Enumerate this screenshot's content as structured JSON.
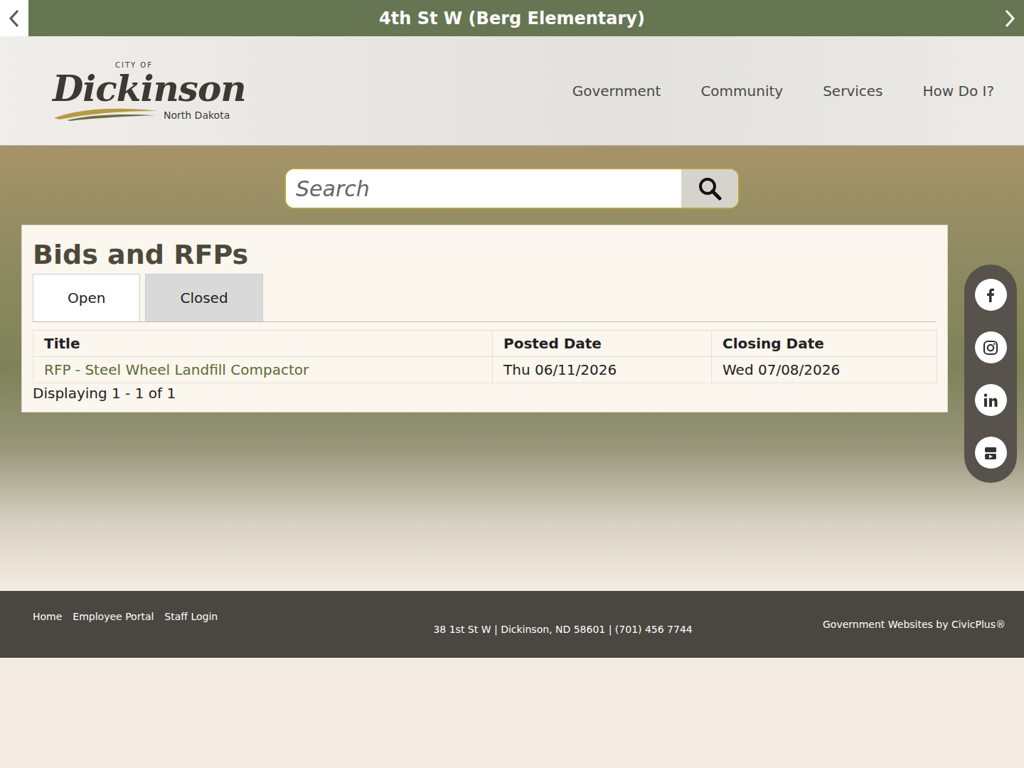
{
  "alert_bar": {
    "title": "4th St W (Berg Elementary)"
  },
  "logo": {
    "prefix": "CITY OF",
    "name": "Dickinson",
    "region": "North Dakota"
  },
  "nav": [
    "Government",
    "Community",
    "Services",
    "How Do I?"
  ],
  "search": {
    "placeholder": "Search"
  },
  "page": {
    "title": "Bids and RFPs"
  },
  "tabs": [
    {
      "label": "Open",
      "selected": true
    },
    {
      "label": "Closed",
      "selected": false
    }
  ],
  "table": {
    "columns": [
      "Title",
      "Posted Date",
      "Closing Date"
    ],
    "rows": [
      {
        "title": "RFP - Steel Wheel Landfill Compactor",
        "posted": "Thu 06/11/2026",
        "closing": "Wed 07/08/2026"
      }
    ]
  },
  "pager": "Displaying 1 - 1 of 1",
  "footer": {
    "links": [
      "Home",
      "Employee Portal",
      "Staff Login"
    ],
    "address": "38 1st St W |  Dickinson, ND 58601 | (701) 456 7744",
    "credit": "Government Websites by CivicPlus®"
  }
}
